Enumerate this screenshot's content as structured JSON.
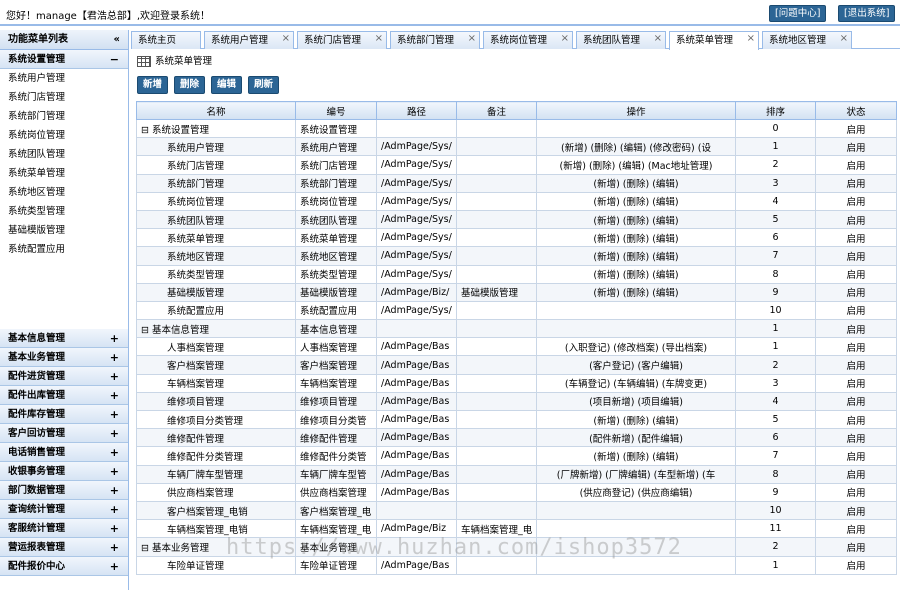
{
  "header": {
    "welcome": "您好！manage【君浩总部】,欢迎登录系统！",
    "help_label": "[问题中心]",
    "exit_label": "[退出系统]"
  },
  "sidebar": {
    "title": "功能菜单列表",
    "collapse_glyph": "«",
    "open_group": {
      "label": "系统设置管理",
      "glyph": "−"
    },
    "items": [
      "系统用户管理",
      "系统门店管理",
      "系统部门管理",
      "系统岗位管理",
      "系统团队管理",
      "系统菜单管理",
      "系统地区管理",
      "系统类型管理",
      "基础模版管理",
      "系统配置应用"
    ],
    "groups": [
      "基本信息管理",
      "基本业务管理",
      "配件进货管理",
      "配件出库管理",
      "配件库存管理",
      "客户回访管理",
      "电话销售管理",
      "收银事务管理",
      "部门数据管理",
      "查询统计管理",
      "客服统计管理",
      "营运报表管理",
      "配件报价中心"
    ],
    "group_glyph": "+"
  },
  "tabs": [
    "系统主页",
    "系统用户管理",
    "系统门店管理",
    "系统部门管理",
    "系统岗位管理",
    "系统团队管理",
    "系统菜单管理",
    "系统地区管理"
  ],
  "tab_close": "×",
  "panel": {
    "title": "系统菜单管理"
  },
  "toolbar": {
    "add": "新增",
    "delete": "删除",
    "edit": "编辑",
    "refresh": "刷新"
  },
  "table": {
    "headers": [
      "名称",
      "编号",
      "路径",
      "备注",
      "操作",
      "排序",
      "状态"
    ],
    "rows": [
      {
        "name": "⊟ 系统设置管理",
        "code": "系统设置管理",
        "path": "",
        "note": "",
        "ops": "",
        "sort": "0",
        "status": "启用",
        "level": 0
      },
      {
        "name": "系统用户管理",
        "code": "系统用户管理",
        "path": "/AdmPage/Sys/",
        "note": "",
        "ops": "(新增)  (删除)  (编辑)  (修改密码)  (设",
        "sort": "1",
        "status": "启用",
        "level": 1
      },
      {
        "name": "系统门店管理",
        "code": "系统门店管理",
        "path": "/AdmPage/Sys/",
        "note": "",
        "ops": "(新增)  (删除)  (编辑)  (Mac地址管理)",
        "sort": "2",
        "status": "启用",
        "level": 1
      },
      {
        "name": "系统部门管理",
        "code": "系统部门管理",
        "path": "/AdmPage/Sys/",
        "note": "",
        "ops": "(新增)  (删除)  (编辑)",
        "sort": "3",
        "status": "启用",
        "level": 1
      },
      {
        "name": "系统岗位管理",
        "code": "系统岗位管理",
        "path": "/AdmPage/Sys/",
        "note": "",
        "ops": "(新增)  (删除)  (编辑)",
        "sort": "4",
        "status": "启用",
        "level": 1
      },
      {
        "name": "系统团队管理",
        "code": "系统团队管理",
        "path": "/AdmPage/Sys/",
        "note": "",
        "ops": "(新增)  (删除)  (编辑)",
        "sort": "5",
        "status": "启用",
        "level": 1
      },
      {
        "name": "系统菜单管理",
        "code": "系统菜单管理",
        "path": "/AdmPage/Sys/",
        "note": "",
        "ops": "(新增)  (删除)  (编辑)",
        "sort": "6",
        "status": "启用",
        "level": 1
      },
      {
        "name": "系统地区管理",
        "code": "系统地区管理",
        "path": "/AdmPage/Sys/",
        "note": "",
        "ops": "(新增)  (删除)  (编辑)",
        "sort": "7",
        "status": "启用",
        "level": 1
      },
      {
        "name": "系统类型管理",
        "code": "系统类型管理",
        "path": "/AdmPage/Sys/",
        "note": "",
        "ops": "(新增)  (删除)  (编辑)",
        "sort": "8",
        "status": "启用",
        "level": 1
      },
      {
        "name": "基础模版管理",
        "code": "基础模版管理",
        "path": "/AdmPage/Biz/",
        "note": "基础模版管理",
        "ops": "(新增)  (删除)  (编辑)",
        "sort": "9",
        "status": "启用",
        "level": 1
      },
      {
        "name": "系统配置应用",
        "code": "系统配置应用",
        "path": "/AdmPage/Sys/",
        "note": "",
        "ops": "",
        "sort": "10",
        "status": "启用",
        "level": 1
      },
      {
        "name": "⊟ 基本信息管理",
        "code": "基本信息管理",
        "path": "",
        "note": "",
        "ops": "",
        "sort": "1",
        "status": "启用",
        "level": 0
      },
      {
        "name": "人事档案管理",
        "code": "人事档案管理",
        "path": "/AdmPage/Bas",
        "note": "",
        "ops": "(入职登记)  (修改档案)  (导出档案)",
        "sort": "1",
        "status": "启用",
        "level": 1
      },
      {
        "name": "客户档案管理",
        "code": "客户档案管理",
        "path": "/AdmPage/Bas",
        "note": "",
        "ops": "(客户登记)  (客户编辑)",
        "sort": "2",
        "status": "启用",
        "level": 1
      },
      {
        "name": "车辆档案管理",
        "code": "车辆档案管理",
        "path": "/AdmPage/Bas",
        "note": "",
        "ops": "(车辆登记)  (车辆编辑)  (车牌变更)",
        "sort": "3",
        "status": "启用",
        "level": 1
      },
      {
        "name": "维修项目管理",
        "code": "维修项目管理",
        "path": "/AdmPage/Bas",
        "note": "",
        "ops": "(项目新增)  (项目编辑)",
        "sort": "4",
        "status": "启用",
        "level": 1
      },
      {
        "name": "维修项目分类管理",
        "code": "维修项目分类管",
        "path": "/AdmPage/Bas",
        "note": "",
        "ops": "(新增)  (删除)  (编辑)",
        "sort": "5",
        "status": "启用",
        "level": 1
      },
      {
        "name": "维修配件管理",
        "code": "维修配件管理",
        "path": "/AdmPage/Bas",
        "note": "",
        "ops": "(配件新增)  (配件编辑)",
        "sort": "6",
        "status": "启用",
        "level": 1
      },
      {
        "name": "维修配件分类管理",
        "code": "维修配件分类管",
        "path": "/AdmPage/Bas",
        "note": "",
        "ops": "(新增)  (删除)  (编辑)",
        "sort": "7",
        "status": "启用",
        "level": 1
      },
      {
        "name": "车辆厂牌车型管理",
        "code": "车辆厂牌车型管",
        "path": "/AdmPage/Bas",
        "note": "",
        "ops": "(厂牌新增)  (厂牌编辑)  (车型新增)  (车",
        "sort": "8",
        "status": "启用",
        "level": 1
      },
      {
        "name": "供应商档案管理",
        "code": "供应商档案管理",
        "path": "/AdmPage/Bas",
        "note": "",
        "ops": "(供应商登记)  (供应商编辑)",
        "sort": "9",
        "status": "启用",
        "level": 1
      },
      {
        "name": "客户档案管理_电销",
        "code": "客户档案管理_电",
        "path": "",
        "note": "",
        "ops": "",
        "sort": "10",
        "status": "启用",
        "level": 1
      },
      {
        "name": "车辆档案管理_电销",
        "code": "车辆档案管理_电",
        "path": "/AdmPage/Biz",
        "note": "车辆档案管理_电",
        "ops": "",
        "sort": "11",
        "status": "启用",
        "level": 1
      },
      {
        "name": "⊟ 基本业务管理",
        "code": "基本业务管理",
        "path": "",
        "note": "",
        "ops": "",
        "sort": "2",
        "status": "启用",
        "level": 0
      },
      {
        "name": "车险单证管理",
        "code": "车险单证管理",
        "path": "/AdmPage/Bas",
        "note": "",
        "ops": "",
        "sort": "1",
        "status": "启用",
        "level": 1
      }
    ]
  },
  "watermark": "https://www.huzhan.com/ishop3572"
}
